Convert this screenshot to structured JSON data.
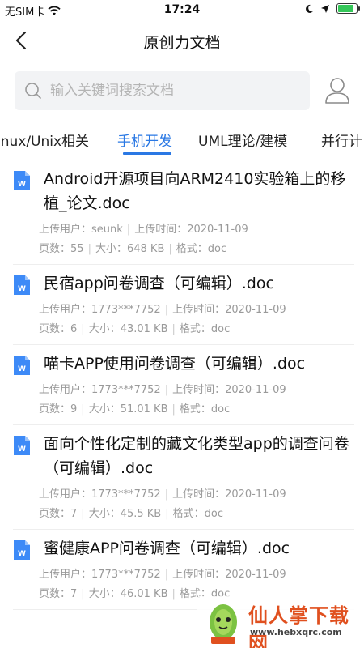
{
  "status_bar": {
    "carrier": "无SIM卡",
    "time": "17:24",
    "battery_level": 0.9
  },
  "nav": {
    "title": "原创力文档"
  },
  "search": {
    "placeholder": "输入关键词搜索文档"
  },
  "tabs": [
    {
      "label": "inux/Unix相关",
      "active": false
    },
    {
      "label": "手机开发",
      "active": true
    },
    {
      "label": "UML理论/建模",
      "active": false
    },
    {
      "label": "并行计",
      "active": false
    }
  ],
  "labels": {
    "uploader": "上传用户：",
    "upload_time": "上传时间：",
    "pages": "页数：",
    "size": "大小：",
    "format": "格式："
  },
  "documents": [
    {
      "title": "Android开源项目向ARM2410实验箱上的移植_论文.doc",
      "uploader": "seunk",
      "time": "2020-11-09",
      "pages": "55",
      "size": "648 KB",
      "format": "doc"
    },
    {
      "title": "民宿app问卷调查（可编辑）.doc",
      "uploader": "1773***7752",
      "time": "2020-11-09",
      "pages": "6",
      "size": "43.01 KB",
      "format": "doc"
    },
    {
      "title": "喵卡APP使用问卷调查（可编辑）.doc",
      "uploader": "1773***7752",
      "time": "2020-11-09",
      "pages": "9",
      "size": "51.01 KB",
      "format": "doc"
    },
    {
      "title": "面向个性化定制的藏文化类型app的调查问卷（可编辑）.doc",
      "uploader": "1773***7752",
      "time": "2020-11-09",
      "pages": "7",
      "size": "45.5 KB",
      "format": "doc"
    },
    {
      "title": "蜜健康APP问卷调查（可编辑）.doc",
      "uploader": "1773***7752",
      "time": "2020-11-09",
      "pages": "7",
      "size": "46.01 KB",
      "format": "doc"
    }
  ],
  "watermark": {
    "text": "仙人掌下载网",
    "url": "www.hebxqrc.com"
  },
  "colors": {
    "accent": "#2a78e4",
    "doc_icon": "#3d8af7",
    "watermark": "#e0501f"
  }
}
